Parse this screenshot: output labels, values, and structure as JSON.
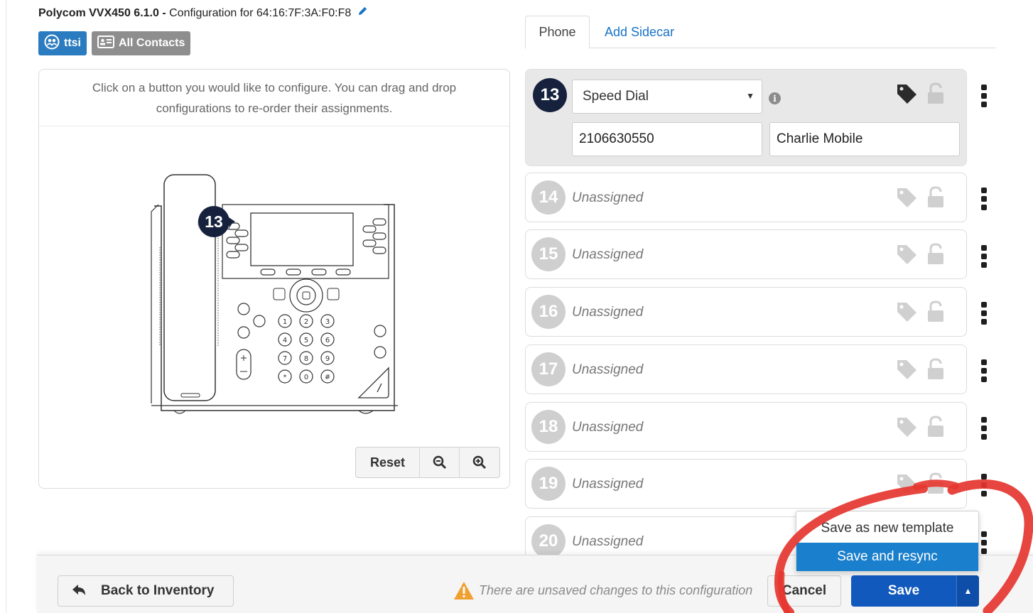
{
  "header": {
    "model": "Polycom VVX450 6.1.0 -",
    "config_text": "Configuration for 64:16:7F:3A:F0:F8",
    "badges": [
      {
        "label": "ttsi",
        "icon": "group-icon"
      },
      {
        "label": "All Contacts",
        "icon": "contact-card-icon"
      }
    ]
  },
  "panel": {
    "hint": "Click on a button you would like to configure. You can drag and drop configurations to re-order their assignments.",
    "selected_marker": "13",
    "reset_label": "Reset",
    "zoom_out_icon": "zoom-out-icon",
    "zoom_in_icon": "zoom-in-icon"
  },
  "tabs": [
    {
      "label": "Phone",
      "active": true
    },
    {
      "label": "Add Sidecar",
      "active": false
    }
  ],
  "keys": {
    "active": {
      "number": "13",
      "type": "Speed Dial",
      "number_value": "2106630550",
      "label_value": "Charlie Mobile"
    },
    "items": [
      {
        "number": "14",
        "status": "Unassigned"
      },
      {
        "number": "15",
        "status": "Unassigned"
      },
      {
        "number": "16",
        "status": "Unassigned"
      },
      {
        "number": "17",
        "status": "Unassigned"
      },
      {
        "number": "18",
        "status": "Unassigned"
      },
      {
        "number": "19",
        "status": "Unassigned"
      },
      {
        "number": "20",
        "status": "Unassigned"
      }
    ]
  },
  "footer": {
    "back_label": "Back to Inventory",
    "warning": "There are unsaved changes to this configuration",
    "cancel_label": "Cancel",
    "save_label": "Save"
  },
  "save_menu": {
    "items": [
      {
        "label": "Save as new template",
        "active": false
      },
      {
        "label": "Save and resync",
        "active": true
      }
    ]
  },
  "colors": {
    "brand_blue": "#1259bd",
    "link_blue": "#1a73c8",
    "active_key": "#16213d",
    "menu_highlight": "#1a7fcc",
    "annotation_red": "#e5352f"
  }
}
